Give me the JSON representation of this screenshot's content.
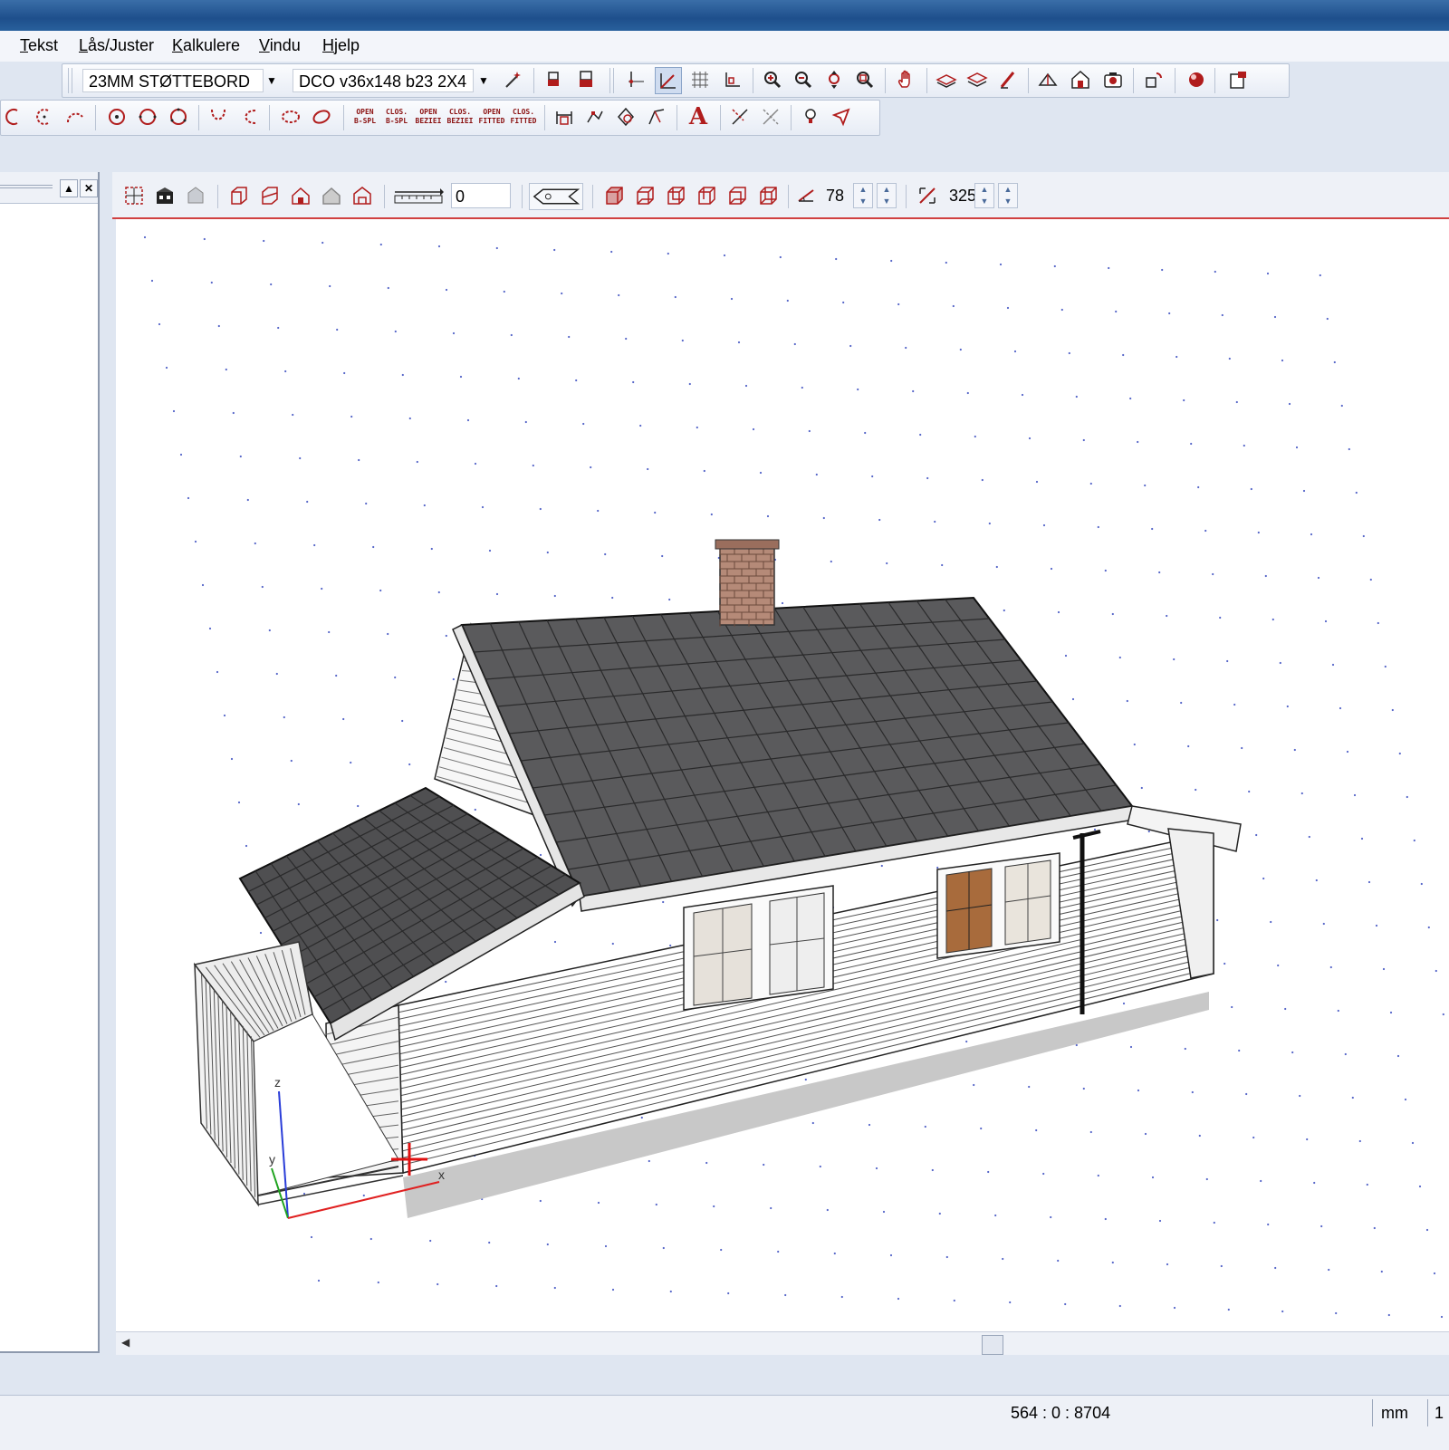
{
  "menu": {
    "items": [
      {
        "accel": "T",
        "rest": "ekst"
      },
      {
        "accel": "L",
        "rest": "ås/Juster"
      },
      {
        "accel": "K",
        "rest": "alkulere"
      },
      {
        "accel": "V",
        "rest": "indu"
      },
      {
        "accel": "H",
        "rest": "jelp"
      }
    ]
  },
  "toolbar": {
    "material_combo": "23MM STØTTEBORD",
    "profile_combo": "DCO v36x148 b23 2X4",
    "spline_buttons": [
      "OPEN\nB-SPL",
      "CLOS.\nB-SPL",
      "OPEN\nBEZIEI",
      "CLOS.\nBEZIEI",
      "OPEN\nFITTED",
      "CLOS.\nFITTED"
    ],
    "text_tool_label": "A"
  },
  "viewbar": {
    "elevation_value": "0",
    "angle_value": "78",
    "rotation_value": "325"
  },
  "axes": {
    "z": "z",
    "y": "y",
    "x": "x"
  },
  "status": {
    "coordinates": "564 : 0 : 8704",
    "unit": "mm",
    "extra": "1"
  },
  "colors": {
    "title_bar": "#2a5c98",
    "icon_red": "#b01c1c",
    "roof": "#5a5a5c",
    "siding": "#ffffff",
    "chimney": "#b58a78"
  }
}
